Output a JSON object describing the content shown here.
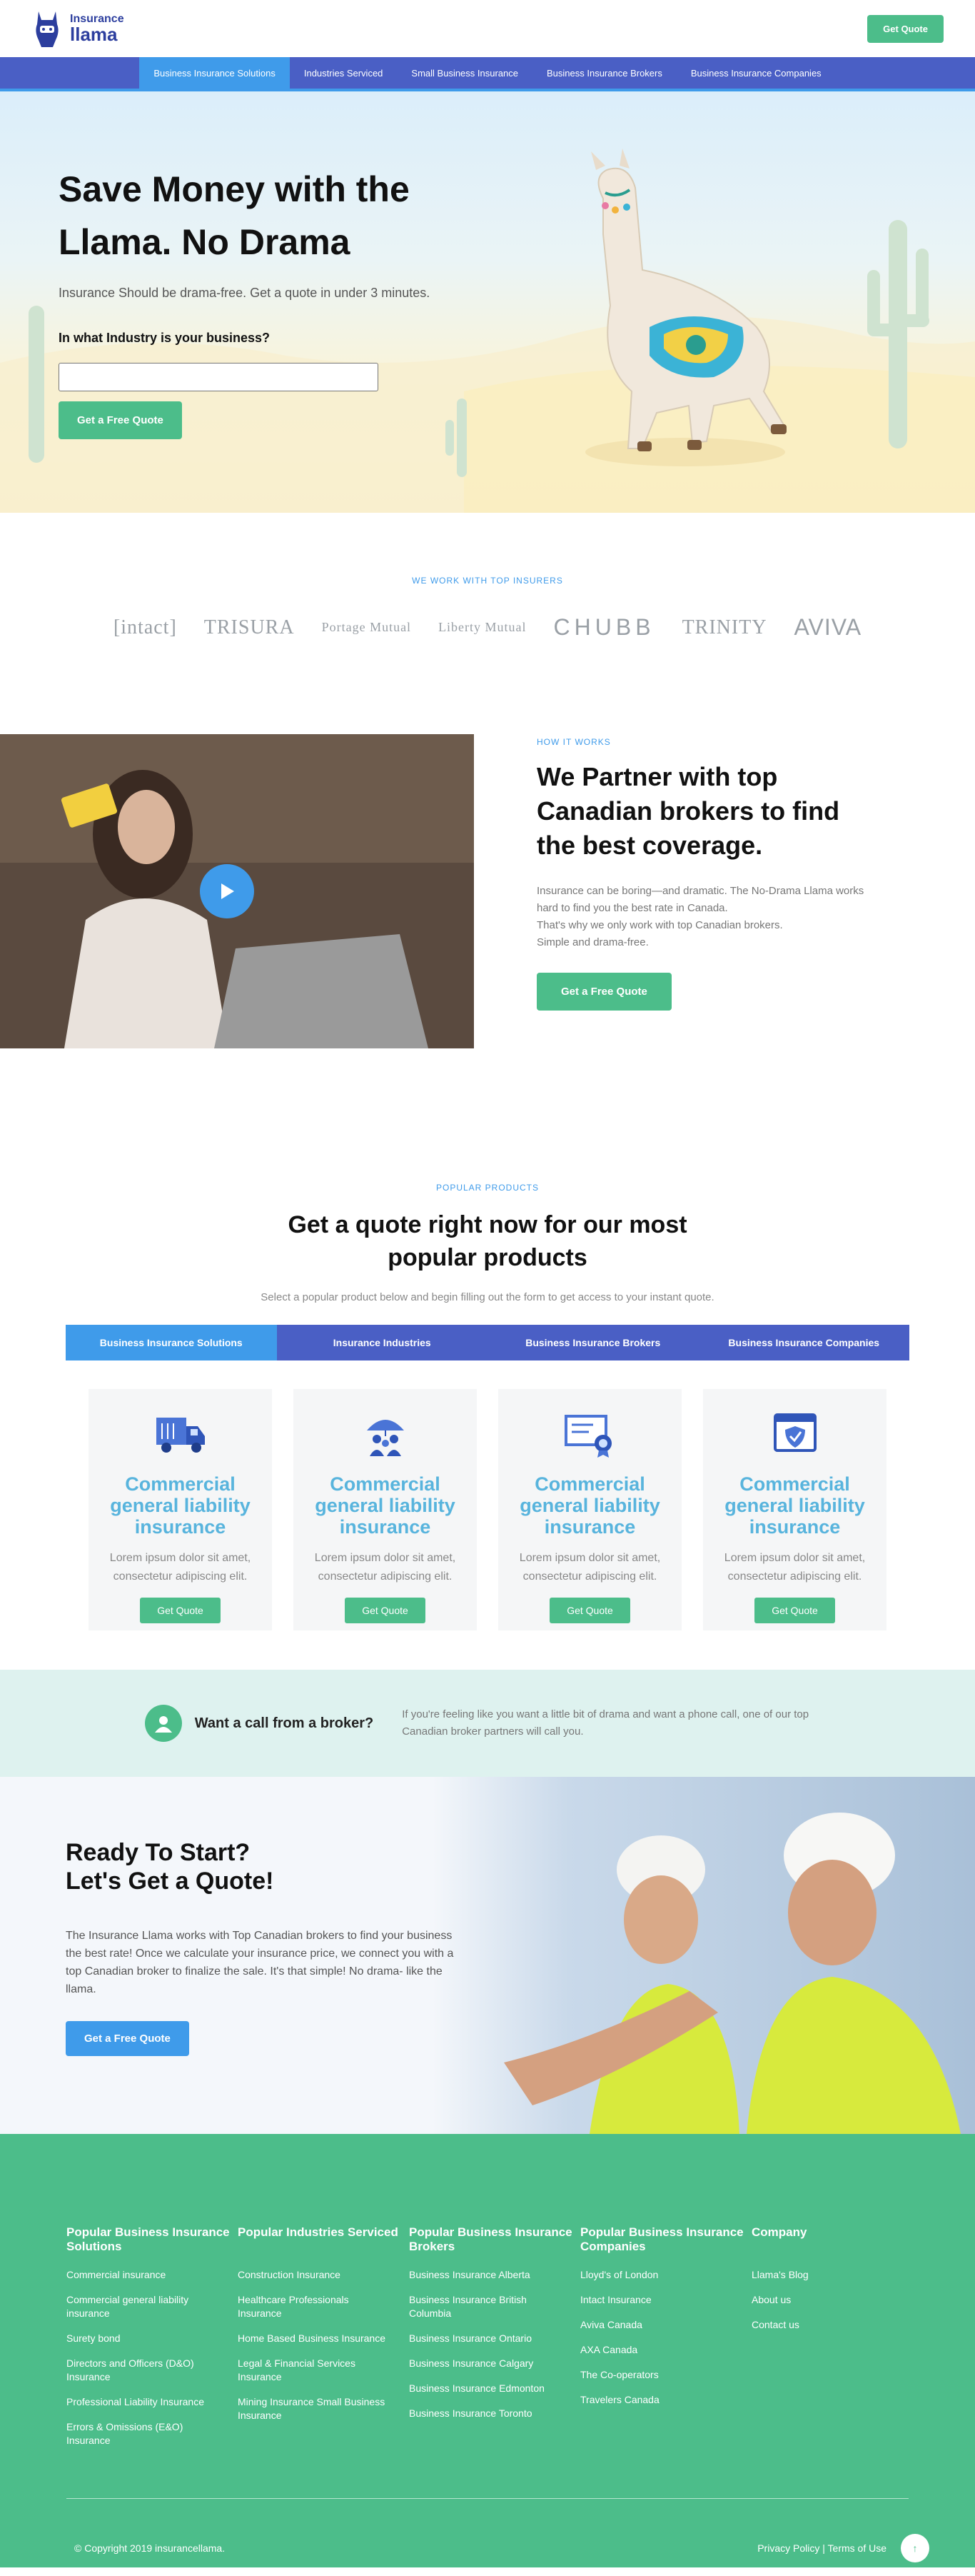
{
  "header": {
    "logo_line1": "Insurance",
    "logo_line2": "llama",
    "cta": "Get Quote"
  },
  "nav": {
    "items": [
      {
        "label": "Business Insurance Solutions",
        "active": true
      },
      {
        "label": "Industries Serviced"
      },
      {
        "label": "Small Business Insurance"
      },
      {
        "label": "Business Insurance Brokers"
      },
      {
        "label": "Business Insurance Companies"
      }
    ]
  },
  "hero": {
    "title": "Save Money with the Llama. No Drama",
    "subtitle": "Insurance Should be drama-free. Get a quote in under 3 minutes.",
    "question": "In what Industry is your business?",
    "input_value": "",
    "cta": "Get a Free Quote"
  },
  "insurers": {
    "eyebrow": "WE WORK WITH TOP INSURERS",
    "logos": [
      "[intact]",
      "TRISURA",
      "Portage Mutual",
      "Liberty Mutual",
      "CHUBB",
      "TRINITY",
      "AVIVA"
    ]
  },
  "how": {
    "eyebrow": "HOW IT WORKS",
    "title": "We Partner with top Canadian brokers to find the best coverage.",
    "body": [
      "Insurance can be boring—and dramatic. The No-Drama Llama works hard to find you the best rate in Canada.",
      "That's why we only work with top Canadian brokers.",
      "Simple and drama-free."
    ],
    "cta": "Get a Free Quote"
  },
  "products": {
    "eyebrow": "POPULAR PRODUCTS",
    "title": "Get a quote right now for our most popular products",
    "subtitle": "Select a popular product below and begin filling out the form to get access to your instant quote.",
    "tabs": [
      {
        "label": "Business Insurance Solutions",
        "active": true
      },
      {
        "label": "Insurance Industries"
      },
      {
        "label": "Business Insurance Brokers"
      },
      {
        "label": "Business Insurance Companies"
      }
    ],
    "cards": [
      {
        "icon": "truck-icon",
        "title": "Commercial general liability insurance",
        "text": "Lorem ipsum dolor sit amet, consectetur adipiscing elit.",
        "cta": "Get Quote"
      },
      {
        "icon": "umbrella-family-icon",
        "title": "Commercial general liability insurance",
        "text": "Lorem ipsum dolor sit amet, consectetur adipiscing elit.",
        "cta": "Get Quote"
      },
      {
        "icon": "certificate-icon",
        "title": "Commercial general liability insurance",
        "text": "Lorem ipsum dolor sit amet, consectetur adipiscing elit.",
        "cta": "Get Quote"
      },
      {
        "icon": "shield-window-icon",
        "title": "Commercial general liability insurance",
        "text": "Lorem ipsum dolor sit amet, consectetur adipiscing elit.",
        "cta": "Get Quote"
      }
    ]
  },
  "callout": {
    "title": "Want a call from a broker?",
    "text": "If you're feeling like you want a little bit of drama and want a phone call, one of our top Canadian broker partners will call you."
  },
  "ready": {
    "title_line1": "Ready To Start?",
    "title_line2": "Let's Get a Quote!",
    "text": "The Insurance Llama works with Top Canadian brokers to find your business the best rate! Once we calculate your insurance price, we connect you with a top Canadian broker to finalize the sale. It's that simple! No drama- like the llama.",
    "cta": "Get a Free Quote"
  },
  "footer": {
    "columns": [
      {
        "heading": "Popular Business Insurance Solutions",
        "links": [
          "Commercial insurance",
          "Commercial general liability insurance",
          "Surety bond",
          "Directors and Officers (D&O) Insurance",
          "Professional Liability Insurance",
          "Errors & Omissions (E&O) Insurance"
        ]
      },
      {
        "heading": "Popular Industries Serviced",
        "links": [
          "Construction Insurance",
          "Healthcare Professionals Insurance",
          "Home Based Business Insurance",
          "Legal & Financial Services Insurance",
          "Mining Insurance Small Business Insurance"
        ]
      },
      {
        "heading": "Popular Business Insurance Brokers",
        "links": [
          "Business Insurance Alberta",
          "Business Insurance British Columbia",
          "Business Insurance Ontario",
          "Business Insurance Calgary",
          "Business Insurance Edmonton",
          "Business Insurance Toronto"
        ]
      },
      {
        "heading": "Popular Business Insurance Companies",
        "links": [
          "Lloyd's of London",
          "Intact Insurance",
          "Aviva Canada",
          "AXA Canada",
          "The Co-operators",
          "Travelers Canada"
        ]
      },
      {
        "heading": "Company",
        "links": [
          "Llama's Blog",
          "About us",
          "Contact us"
        ]
      }
    ],
    "copyright": "© Copyright 2019 insurancellama.",
    "privacy": "Privacy Policy",
    "separator": "|",
    "terms": "Terms of Use",
    "top_arrow": "↑"
  },
  "colors": {
    "green": "#4cbd8a",
    "blue": "#3f9bea",
    "navy": "#4a5fc5",
    "card_title": "#58b4dd"
  }
}
